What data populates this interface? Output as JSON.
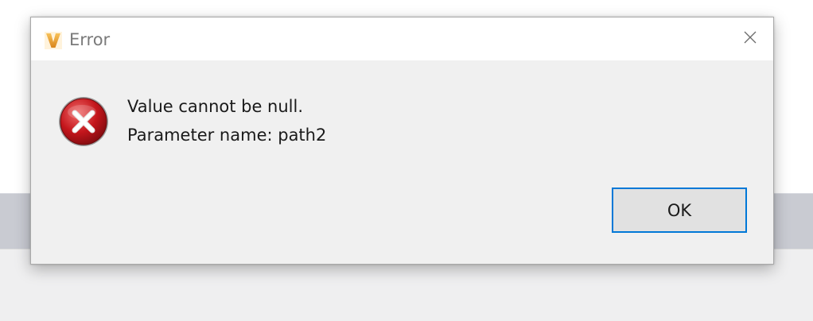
{
  "dialog": {
    "title": "Error",
    "app_icon": "v-logo-icon",
    "close_icon": "close-icon",
    "error_icon": "error-x-icon",
    "message_line1": "Value cannot be null.",
    "message_line2": "Parameter name: path2",
    "ok_label": "OK"
  },
  "colors": {
    "accent": "#0078d7",
    "error_red": "#c4161c",
    "logo_orange": "#f0a020"
  }
}
